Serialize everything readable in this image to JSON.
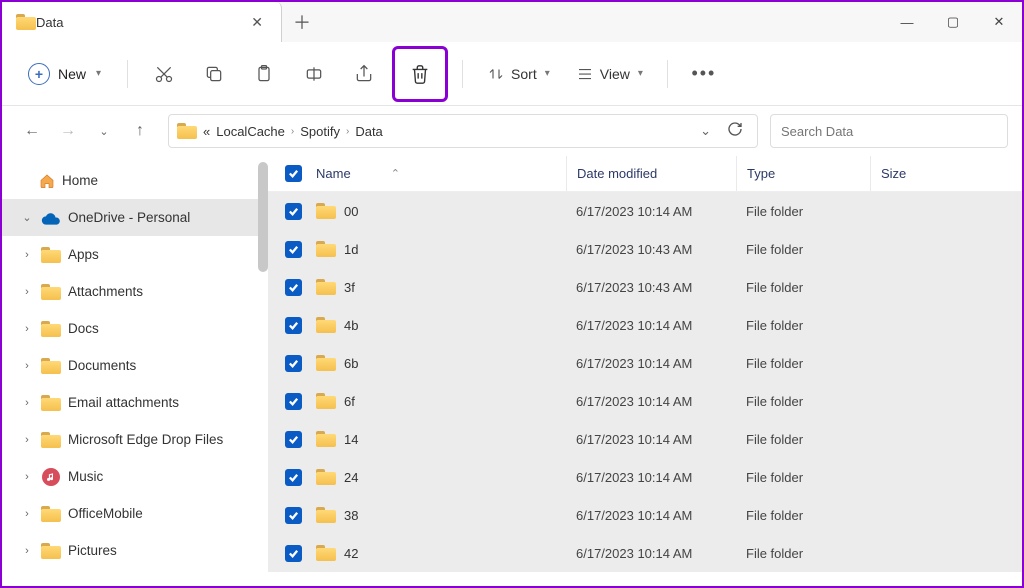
{
  "window": {
    "tab_title": "Data",
    "new_label": "New",
    "sort_label": "Sort",
    "view_label": "View"
  },
  "breadcrumb": {
    "ellipsis": "«",
    "parts": [
      "LocalCache",
      "Spotify",
      "Data"
    ]
  },
  "search": {
    "placeholder": "Search Data"
  },
  "sidebar": {
    "home": "Home",
    "onedrive": "OneDrive - Personal",
    "items": [
      "Apps",
      "Attachments",
      "Docs",
      "Documents",
      "Email attachments",
      "Microsoft Edge Drop Files",
      "Music",
      "OfficeMobile",
      "Pictures"
    ]
  },
  "columns": {
    "name": "Name",
    "date": "Date modified",
    "type": "Type",
    "size": "Size"
  },
  "files": [
    {
      "name": "00",
      "date": "6/17/2023 10:14 AM",
      "type": "File folder"
    },
    {
      "name": "1d",
      "date": "6/17/2023 10:43 AM",
      "type": "File folder"
    },
    {
      "name": "3f",
      "date": "6/17/2023 10:43 AM",
      "type": "File folder"
    },
    {
      "name": "4b",
      "date": "6/17/2023 10:14 AM",
      "type": "File folder"
    },
    {
      "name": "6b",
      "date": "6/17/2023 10:14 AM",
      "type": "File folder"
    },
    {
      "name": "6f",
      "date": "6/17/2023 10:14 AM",
      "type": "File folder"
    },
    {
      "name": "14",
      "date": "6/17/2023 10:14 AM",
      "type": "File folder"
    },
    {
      "name": "24",
      "date": "6/17/2023 10:14 AM",
      "type": "File folder"
    },
    {
      "name": "38",
      "date": "6/17/2023 10:14 AM",
      "type": "File folder"
    },
    {
      "name": "42",
      "date": "6/17/2023 10:14 AM",
      "type": "File folder"
    }
  ]
}
